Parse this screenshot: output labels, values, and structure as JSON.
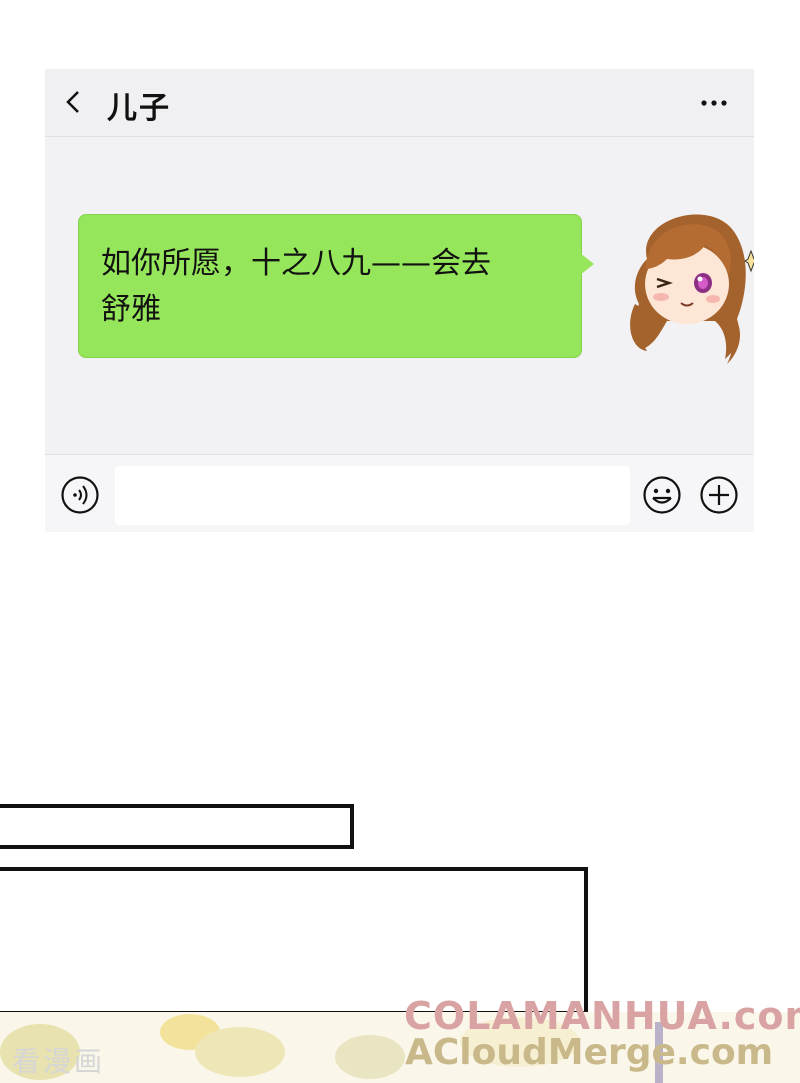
{
  "header": {
    "title": "儿子",
    "back_icon": "chevron-left-icon",
    "more_icon": "more-dots-icon"
  },
  "message": {
    "text_line1": "如你所愿，十之八九——会去",
    "text_line2": "舒雅",
    "bubble_color": "#95e65a",
    "avatar_icon": "anime-girl-avatar"
  },
  "input_bar": {
    "value": "",
    "placeholder": "",
    "voice_icon": "voice-icon",
    "emoji_icon": "emoji-icon",
    "plus_icon": "plus-icon"
  },
  "watermarks": {
    "line1": "COLAMANHUA.com",
    "line2": "ACloudMerge.com",
    "line3": "看漫画"
  }
}
